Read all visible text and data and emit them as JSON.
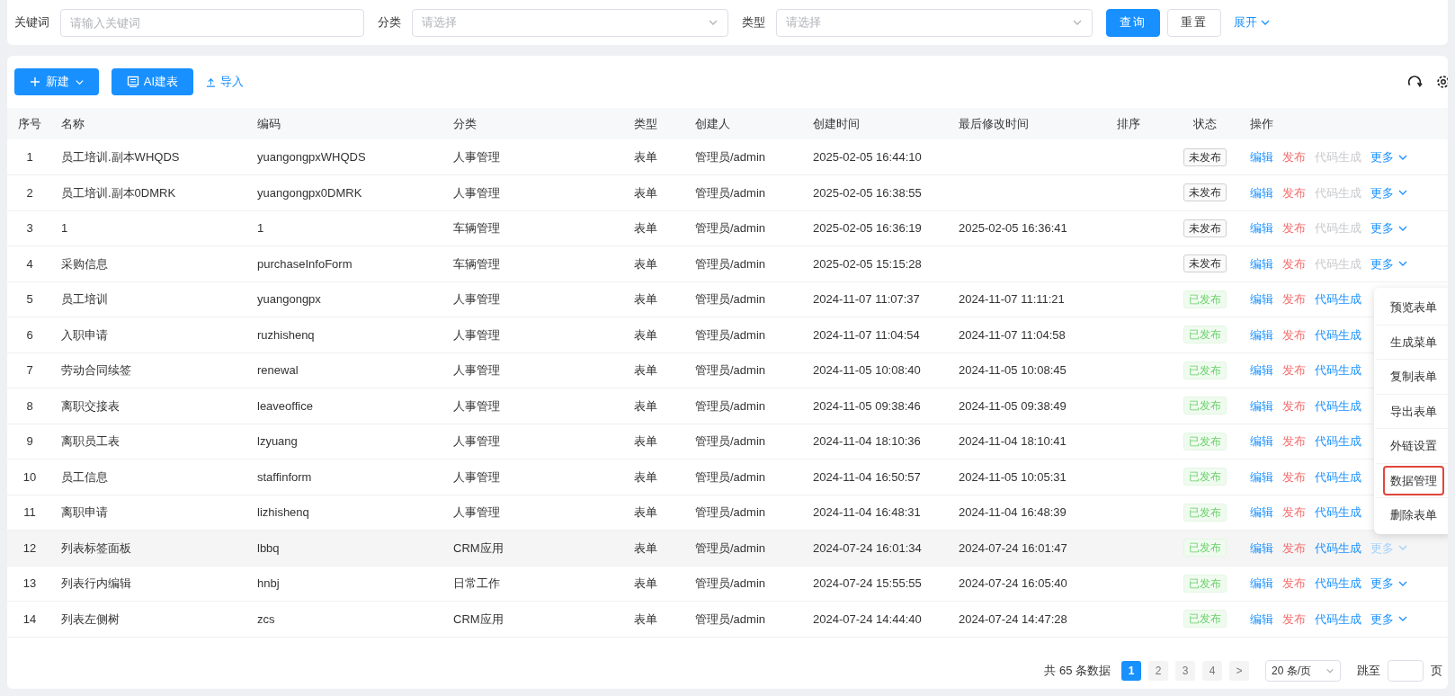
{
  "filters": [
    {
      "label": "关键词",
      "kind": "input",
      "placeholder": "请输入关键词"
    },
    {
      "label": "分类",
      "kind": "select",
      "placeholder": "请选择"
    },
    {
      "label": "类型",
      "kind": "select",
      "placeholder": "请选择"
    }
  ],
  "search_buttons": [
    {
      "label": "查询",
      "kind": "primary"
    },
    {
      "label": "重置",
      "kind": "default"
    }
  ],
  "expand_link": "展开",
  "toolbar": [
    {
      "label": "新建",
      "kind": "dropdown"
    },
    {
      "label": "AI建表",
      "kind": "ai"
    },
    {
      "label": "导入",
      "kind": "link"
    }
  ],
  "columns": [
    "序号",
    "名称",
    "编码",
    "分类",
    "类型",
    "创建人",
    "创建时间",
    "最后修改时间",
    "排序",
    "状态",
    "操作"
  ],
  "rows": [
    {
      "no": "1",
      "name": "员工培训.副本WHQDS",
      "code": "yuangongpxWHQDS",
      "category": "人事管理",
      "type": "表单",
      "creator": "管理员/admin",
      "created": "2025-02-05 16:44:10",
      "status": "未发布",
      "published": false,
      "active": false,
      "edit": "编辑",
      "publish": "发布",
      "codegen": "代码生成",
      "more": "更多"
    },
    {
      "no": "2",
      "name": "员工培训.副本0DMRK",
      "code": "yuangongpx0DMRK",
      "category": "人事管理",
      "type": "表单",
      "creator": "管理员/admin",
      "created": "2025-02-05 16:38:55",
      "status": "未发布",
      "published": false,
      "active": false,
      "edit": "编辑",
      "publish": "发布",
      "codegen": "代码生成",
      "more": "更多"
    },
    {
      "no": "3",
      "name": "1",
      "code": "1",
      "category": "车辆管理",
      "type": "表单",
      "creator": "管理员/admin",
      "created": "2025-02-05 16:36:19",
      "modified": "2025-02-05 16:36:41",
      "status": "未发布",
      "published": false,
      "active": false,
      "edit": "编辑",
      "publish": "发布",
      "codegen": "代码生成",
      "more": "更多"
    },
    {
      "no": "4",
      "name": "采购信息",
      "code": "purchaseInfoForm",
      "category": "车辆管理",
      "type": "表单",
      "creator": "管理员/admin",
      "created": "2025-02-05 15:15:28",
      "status": "未发布",
      "published": false,
      "active": false,
      "edit": "编辑",
      "publish": "发布",
      "codegen": "代码生成",
      "more": "更多"
    },
    {
      "no": "5",
      "name": "员工培训",
      "code": "yuangongpx",
      "category": "人事管理",
      "type": "表单",
      "creator": "管理员/admin",
      "created": "2024-11-07 11:07:37",
      "modified": "2024-11-07 11:11:21",
      "status": "已发布",
      "published": true,
      "active": false,
      "edit": "编辑",
      "publish": "发布",
      "codegen": "代码生成"
    },
    {
      "no": "6",
      "name": "入职申请",
      "code": "ruzhishenq",
      "category": "人事管理",
      "type": "表单",
      "creator": "管理员/admin",
      "created": "2024-11-07 11:04:54",
      "modified": "2024-11-07 11:04:58",
      "status": "已发布",
      "published": true,
      "active": false,
      "edit": "编辑",
      "publish": "发布",
      "codegen": "代码生成"
    },
    {
      "no": "7",
      "name": "劳动合同续签",
      "code": "renewal",
      "category": "人事管理",
      "type": "表单",
      "creator": "管理员/admin",
      "created": "2024-11-05 10:08:40",
      "modified": "2024-11-05 10:08:45",
      "status": "已发布",
      "published": true,
      "active": false,
      "edit": "编辑",
      "publish": "发布",
      "codegen": "代码生成"
    },
    {
      "no": "8",
      "name": "离职交接表",
      "code": "leaveoffice",
      "category": "人事管理",
      "type": "表单",
      "creator": "管理员/admin",
      "created": "2024-11-05 09:38:46",
      "modified": "2024-11-05 09:38:49",
      "status": "已发布",
      "published": true,
      "active": false,
      "edit": "编辑",
      "publish": "发布",
      "codegen": "代码生成"
    },
    {
      "no": "9",
      "name": "离职员工表",
      "code": "lzyuang",
      "category": "人事管理",
      "type": "表单",
      "creator": "管理员/admin",
      "created": "2024-11-04 18:10:36",
      "modified": "2024-11-04 18:10:41",
      "status": "已发布",
      "published": true,
      "active": false,
      "edit": "编辑",
      "publish": "发布",
      "codegen": "代码生成"
    },
    {
      "no": "10",
      "name": "员工信息",
      "code": "staffinform",
      "category": "人事管理",
      "type": "表单",
      "creator": "管理员/admin",
      "created": "2024-11-04 16:50:57",
      "modified": "2024-11-05 10:05:31",
      "status": "已发布",
      "published": true,
      "active": false,
      "edit": "编辑",
      "publish": "发布",
      "codegen": "代码生成"
    },
    {
      "no": "11",
      "name": "离职申请",
      "code": "lizhishenq",
      "category": "人事管理",
      "type": "表单",
      "creator": "管理员/admin",
      "created": "2024-11-04 16:48:31",
      "modified": "2024-11-04 16:48:39",
      "status": "已发布",
      "published": true,
      "active": false,
      "edit": "编辑",
      "publish": "发布",
      "codegen": "代码生成"
    },
    {
      "no": "12",
      "name": "列表标签面板",
      "code": "lbbq",
      "category": "CRM应用",
      "type": "表单",
      "creator": "管理员/admin",
      "created": "2024-07-24 16:01:34",
      "modified": "2024-07-24 16:01:47",
      "status": "已发布",
      "published": true,
      "active": true,
      "edit": "编辑",
      "publish": "发布",
      "codegen": "代码生成",
      "more": "更多"
    },
    {
      "no": "13",
      "name": "列表行内编辑",
      "code": "hnbj",
      "category": "日常工作",
      "type": "表单",
      "creator": "管理员/admin",
      "created": "2024-07-24 15:55:55",
      "modified": "2024-07-24 16:05:40",
      "status": "已发布",
      "published": true,
      "active": false,
      "edit": "编辑",
      "publish": "发布",
      "codegen": "代码生成",
      "more": "更多"
    },
    {
      "no": "14",
      "name": "列表左侧树",
      "code": "zcs",
      "category": "CRM应用",
      "type": "表单",
      "creator": "管理员/admin",
      "created": "2024-07-24 14:44:40",
      "modified": "2024-07-24 14:47:28",
      "status": "已发布",
      "published": true,
      "active": false,
      "edit": "编辑",
      "publish": "发布",
      "codegen": "代码生成",
      "more": "更多"
    }
  ],
  "more_menu": [
    {
      "label": "预览表单",
      "highlighted": false
    },
    {
      "label": "生成菜单",
      "highlighted": false
    },
    {
      "label": "复制表单",
      "highlighted": false
    },
    {
      "label": "导出表单",
      "highlighted": false
    },
    {
      "label": "外链设置",
      "highlighted": false
    },
    {
      "label": "数据管理",
      "highlighted": true
    },
    {
      "label": "删除表单",
      "highlighted": false
    }
  ],
  "pagination": {
    "total": "共 65 条数据",
    "pages": [
      {
        "label": "1",
        "selected": true
      },
      {
        "label": "2",
        "selected": false
      },
      {
        "label": "3",
        "selected": false
      },
      {
        "label": "4",
        "selected": false
      }
    ],
    "next": ">",
    "page_size": "20 条/页",
    "jump_label": "跳至",
    "page_unit": "页"
  }
}
